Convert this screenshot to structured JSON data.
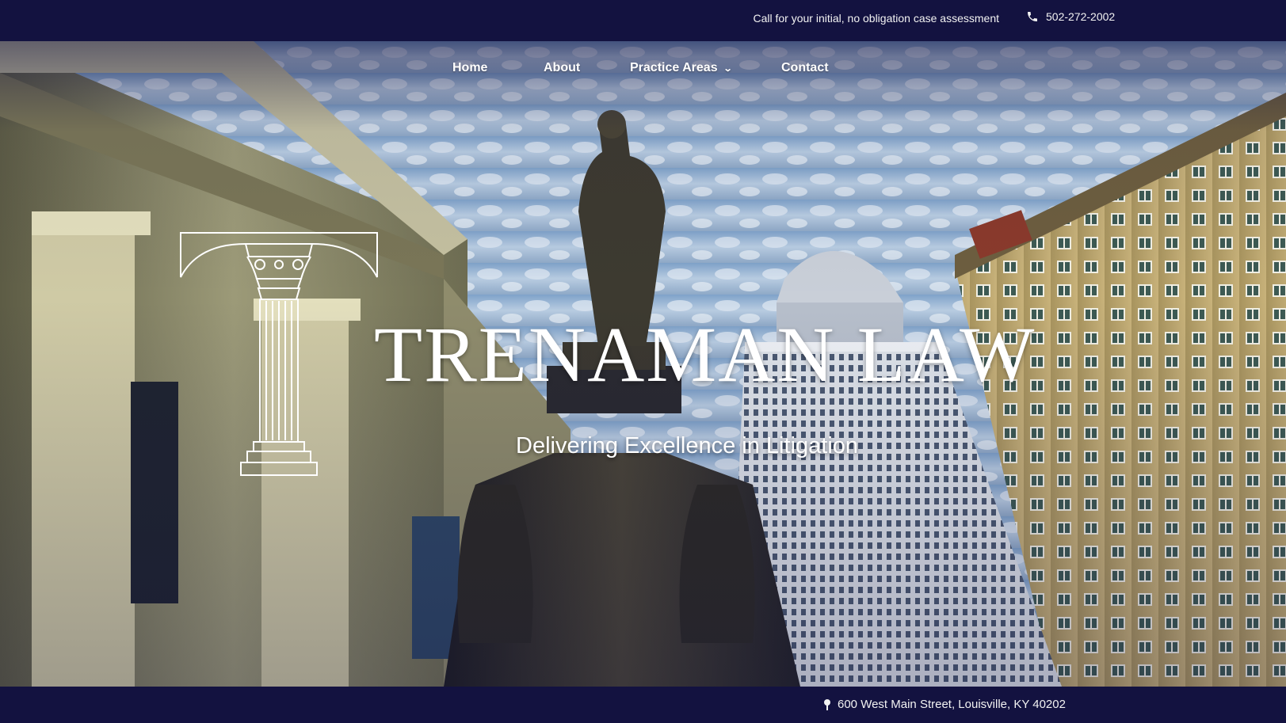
{
  "topbar": {
    "cta_text": "Call for your initial, no obligation case assessment",
    "phone_icon": "phone-icon",
    "phone": "502-272-2002"
  },
  "nav": {
    "items": [
      {
        "label": "Home"
      },
      {
        "label": "About"
      },
      {
        "label": "Practice Areas",
        "icon": "chevron-down-icon"
      },
      {
        "label": "Contact"
      }
    ]
  },
  "hero": {
    "brand_name": "TRENAMAN LAW",
    "tagline": "Delivering Excellence in Litigation",
    "logo_icon": "column-icon"
  },
  "footer": {
    "pin_icon": "map-pin-icon",
    "address": "600 West Main Street, Louisville, KY 40202"
  },
  "colors": {
    "bar_background": "#131240",
    "text": "#ffffff"
  }
}
